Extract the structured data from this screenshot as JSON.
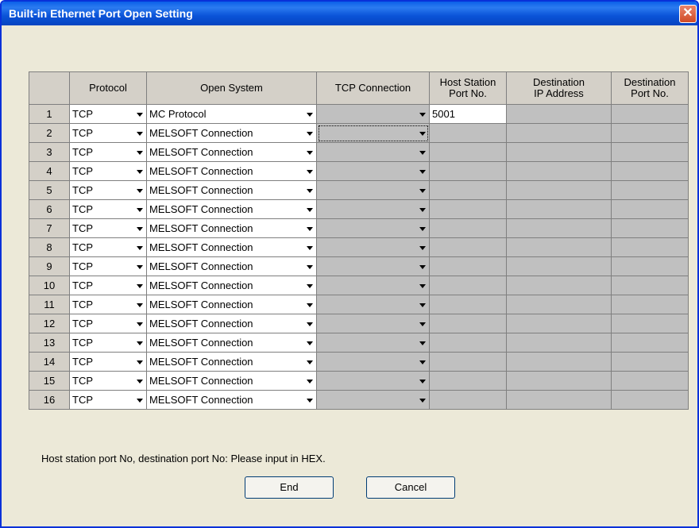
{
  "window": {
    "title": "Built-in Ethernet Port Open Setting",
    "close_glyph": "✕"
  },
  "grid": {
    "headers": {
      "row": "",
      "protocol": "Protocol",
      "open_system": "Open System",
      "tcp_connection": "TCP Connection",
      "host_port_line1": "Host Station",
      "host_port_line2": "Port No.",
      "dest_ip_line1": "Destination",
      "dest_ip_line2": "IP Address",
      "dest_port_line1": "Destination",
      "dest_port_line2": "Port No."
    },
    "rows": [
      {
        "no": "1",
        "protocol": "TCP",
        "open_system": "MC Protocol",
        "tcp_connection": "",
        "host_port": "5001",
        "dest_ip": "",
        "dest_port": ""
      },
      {
        "no": "2",
        "protocol": "TCP",
        "open_system": "MELSOFT Connection",
        "tcp_connection": "",
        "host_port": "",
        "dest_ip": "",
        "dest_port": ""
      },
      {
        "no": "3",
        "protocol": "TCP",
        "open_system": "MELSOFT Connection",
        "tcp_connection": "",
        "host_port": "",
        "dest_ip": "",
        "dest_port": ""
      },
      {
        "no": "4",
        "protocol": "TCP",
        "open_system": "MELSOFT Connection",
        "tcp_connection": "",
        "host_port": "",
        "dest_ip": "",
        "dest_port": ""
      },
      {
        "no": "5",
        "protocol": "TCP",
        "open_system": "MELSOFT Connection",
        "tcp_connection": "",
        "host_port": "",
        "dest_ip": "",
        "dest_port": ""
      },
      {
        "no": "6",
        "protocol": "TCP",
        "open_system": "MELSOFT Connection",
        "tcp_connection": "",
        "host_port": "",
        "dest_ip": "",
        "dest_port": ""
      },
      {
        "no": "7",
        "protocol": "TCP",
        "open_system": "MELSOFT Connection",
        "tcp_connection": "",
        "host_port": "",
        "dest_ip": "",
        "dest_port": ""
      },
      {
        "no": "8",
        "protocol": "TCP",
        "open_system": "MELSOFT Connection",
        "tcp_connection": "",
        "host_port": "",
        "dest_ip": "",
        "dest_port": ""
      },
      {
        "no": "9",
        "protocol": "TCP",
        "open_system": "MELSOFT Connection",
        "tcp_connection": "",
        "host_port": "",
        "dest_ip": "",
        "dest_port": ""
      },
      {
        "no": "10",
        "protocol": "TCP",
        "open_system": "MELSOFT Connection",
        "tcp_connection": "",
        "host_port": "",
        "dest_ip": "",
        "dest_port": ""
      },
      {
        "no": "11",
        "protocol": "TCP",
        "open_system": "MELSOFT Connection",
        "tcp_connection": "",
        "host_port": "",
        "dest_ip": "",
        "dest_port": ""
      },
      {
        "no": "12",
        "protocol": "TCP",
        "open_system": "MELSOFT Connection",
        "tcp_connection": "",
        "host_port": "",
        "dest_ip": "",
        "dest_port": ""
      },
      {
        "no": "13",
        "protocol": "TCP",
        "open_system": "MELSOFT Connection",
        "tcp_connection": "",
        "host_port": "",
        "dest_ip": "",
        "dest_port": ""
      },
      {
        "no": "14",
        "protocol": "TCP",
        "open_system": "MELSOFT Connection",
        "tcp_connection": "",
        "host_port": "",
        "dest_ip": "",
        "dest_port": ""
      },
      {
        "no": "15",
        "protocol": "TCP",
        "open_system": "MELSOFT Connection",
        "tcp_connection": "",
        "host_port": "",
        "dest_ip": "",
        "dest_port": ""
      },
      {
        "no": "16",
        "protocol": "TCP",
        "open_system": "MELSOFT Connection",
        "tcp_connection": "",
        "host_port": "",
        "dest_ip": "",
        "dest_port": ""
      }
    ]
  },
  "note": "Host station port No, destination port No: Please input in HEX.",
  "buttons": {
    "end": "End",
    "cancel": "Cancel"
  },
  "colors": {
    "titlebar": "#0a53d8",
    "dialog_bg": "#ece9d8",
    "disabled_cell": "#c0c0c0"
  }
}
